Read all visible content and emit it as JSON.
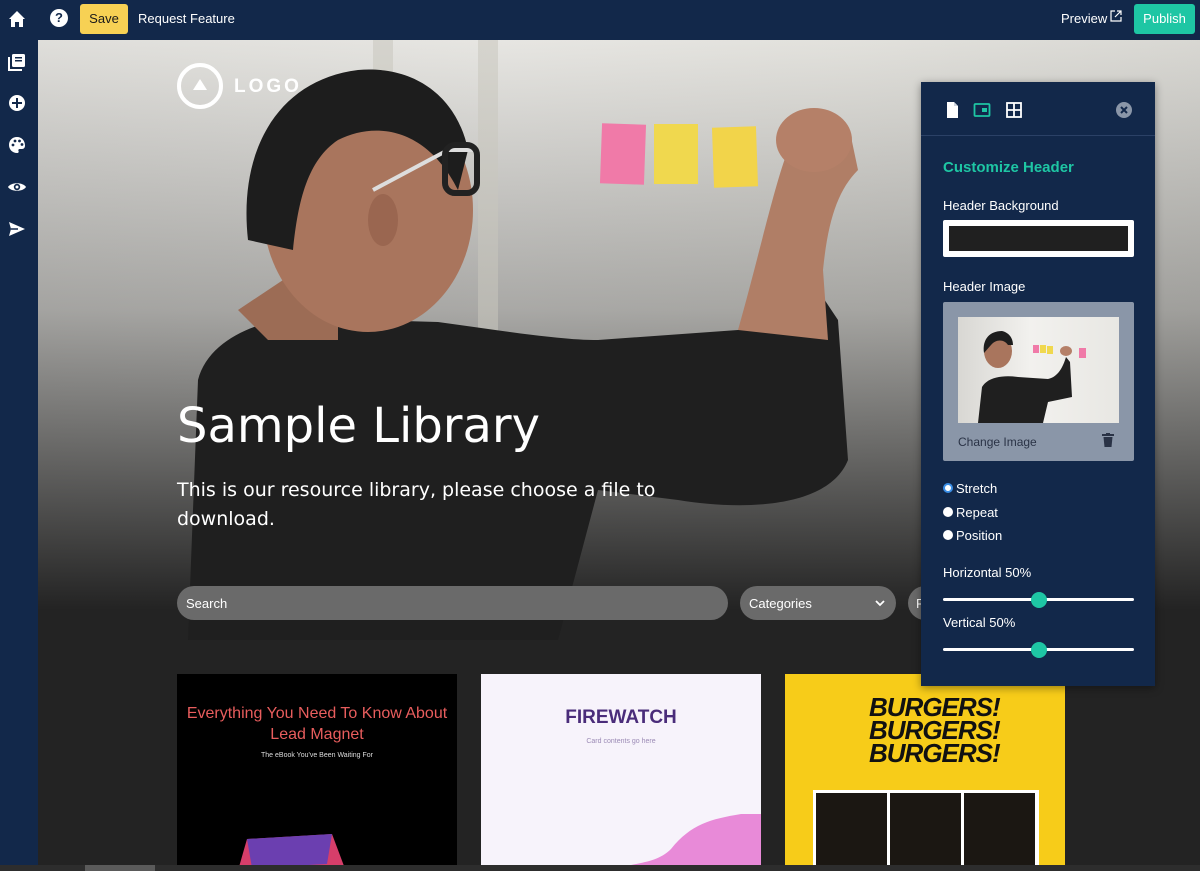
{
  "topbar": {
    "home_icon": "home-icon",
    "help_label": "?",
    "save_label": "Save",
    "request_feature_label": "Request Feature",
    "preview_label": "Preview",
    "publish_label": "Publish",
    "colors": {
      "save": "#f7d154",
      "publish": "#1ec6a4",
      "bar": "#12284a"
    }
  },
  "sidebar": {
    "items": [
      {
        "icon": "library-icon"
      },
      {
        "icon": "add-icon"
      },
      {
        "icon": "palette-icon"
      },
      {
        "icon": "eye-icon"
      },
      {
        "icon": "send-icon"
      }
    ]
  },
  "hero": {
    "logo_text": "LOGO",
    "title": "Sample Library",
    "subtitle": "This is our resource library, please choose a file to download.",
    "search_placeholder": "Search",
    "categories_label": "Categories",
    "third_filter_label": "F"
  },
  "cards": [
    {
      "title": "Everything You Need To Know About Lead Magnet",
      "subtitle": "The eBook You've Been Waiting For"
    },
    {
      "title": "FIREWATCH",
      "subtitle": "Card contents go here"
    },
    {
      "title": "BURGERS! BURGERS! BURGERS!"
    }
  ],
  "panel": {
    "heading": "Customize Header",
    "header_background_label": "Header Background",
    "header_background_color": "#202020",
    "header_image_label": "Header Image",
    "change_image_label": "Change Image",
    "options": [
      {
        "label": "Stretch",
        "selected": true
      },
      {
        "label": "Repeat",
        "selected": false
      },
      {
        "label": "Position",
        "selected": false
      }
    ],
    "horizontal_label": "Horizontal 50%",
    "horizontal_value": 0.5,
    "vertical_label": "Vertical 50%",
    "vertical_value": 0.5,
    "accent": "#1ec6a4"
  }
}
